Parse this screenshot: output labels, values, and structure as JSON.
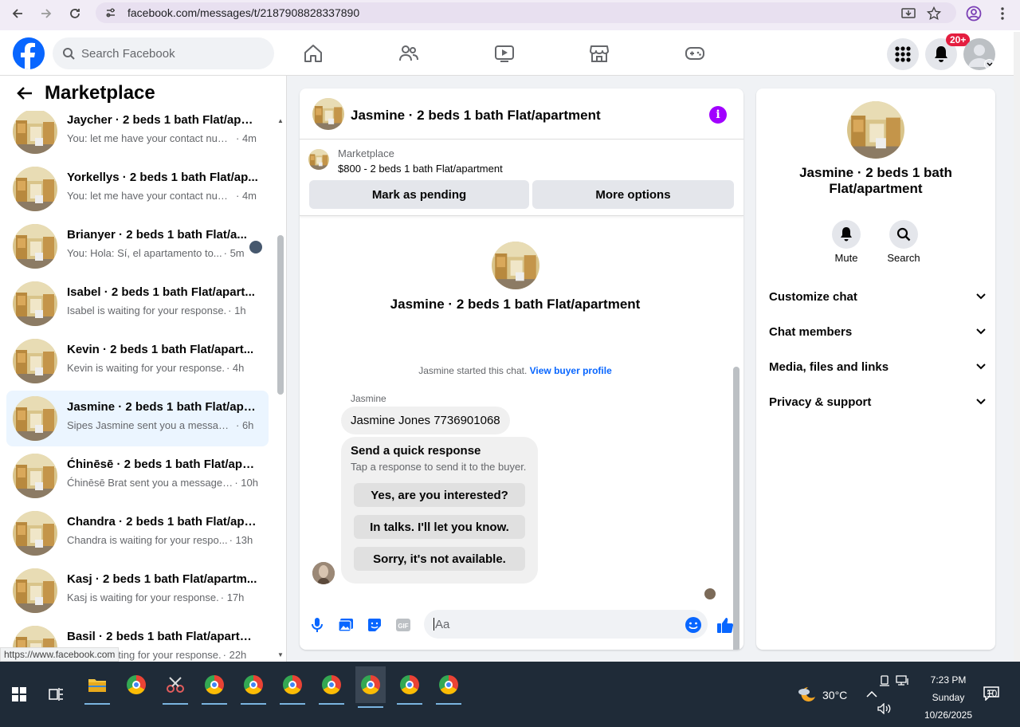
{
  "browser": {
    "url": "facebook.com/messages/t/2187908828337890",
    "status_url": "https://www.facebook.com"
  },
  "fb": {
    "search_placeholder": "Search Facebook",
    "notification_badge": "20+"
  },
  "sidebar": {
    "title": "Marketplace",
    "conversations": [
      {
        "title": "Jaycher · 2 beds 1 bath Flat/apartment",
        "preview": "You: let me have your contact num...",
        "time": "· 4m",
        "active": false
      },
      {
        "title": "Yorkellys · 2 beds 1 bath Flat/ap...",
        "preview": "You: let me have your contact num...",
        "time": "· 4m",
        "active": false
      },
      {
        "title": "Brianyer · 2 beds 1 bath Flat/a...",
        "preview": "You: Hola: Sí, el apartamento to...",
        "time": "· 5m",
        "active": false
      },
      {
        "title": "Isabel · 2 beds 1 bath Flat/apart...",
        "preview": "Isabel is waiting for your response.",
        "time": "· 1h",
        "active": false
      },
      {
        "title": "Kevin · 2 beds 1 bath Flat/apart...",
        "preview": "Kevin is waiting for your response.",
        "time": "· 4h",
        "active": false
      },
      {
        "title": "Jasmine · 2 beds 1 bath Flat/apa...",
        "preview": "Sipes Jasmine sent you a message ...",
        "time": "· 6h",
        "active": true
      },
      {
        "title": "Ćhinēsē · 2 beds 1 bath Flat/apar...",
        "preview": "Ćhinēsē Brat sent you a message ...",
        "time": "· 10h",
        "active": false
      },
      {
        "title": "Chandra · 2 beds 1 bath Flat/apa...",
        "preview": "Chandra is waiting for your respo...",
        "time": "· 13h",
        "active": false
      },
      {
        "title": "Kasj · 2 beds 1 bath Flat/apartm...",
        "preview": "Kasj is waiting for your response.",
        "time": "· 17h",
        "active": false
      },
      {
        "title": "Basil · 2 beds 1 bath Flat/apartm...",
        "preview": "Basil is waiting for your response.",
        "time": "· 22h",
        "active": false
      }
    ]
  },
  "chat": {
    "header_title": "Jasmine · 2 beds 1 bath Flat/apartment",
    "listing_label": "Marketplace",
    "listing_price": "$800 - 2 beds 1 bath Flat/apartment",
    "mark_pending": "Mark as pending",
    "more_options": "More options",
    "intro_title": "Jasmine · 2 beds 1 bath Flat/apartment",
    "started_text": "Jasmine started this chat.",
    "buyer_profile_link": "View buyer profile",
    "sender_name": "Jasmine",
    "message_1": "Jasmine Jones 7736901068",
    "quick_title": "Send a quick response",
    "quick_sub": "Tap a response to send it to the buyer.",
    "quick_responses": [
      "Yes, are you interested?",
      "In talks. I'll let you know.",
      "Sorry, it's not available."
    ],
    "composer_placeholder": "Aa"
  },
  "right_panel": {
    "title": "Jasmine · 2 beds 1 bath Flat/apartment",
    "mute_label": "Mute",
    "search_label": "Search",
    "rows": [
      "Customize chat",
      "Chat members",
      "Media, files and links",
      "Privacy & support"
    ]
  },
  "taskbar": {
    "weather_temp": "30°C",
    "time": "7:23 PM",
    "day": "Sunday",
    "date": "10/26/2025",
    "notification_count": "10"
  },
  "colors": {
    "fb_blue": "#0866ff",
    "info_purple": "#a100ff",
    "badge_red": "#e41e3f",
    "active_row": "#ebf5ff"
  }
}
